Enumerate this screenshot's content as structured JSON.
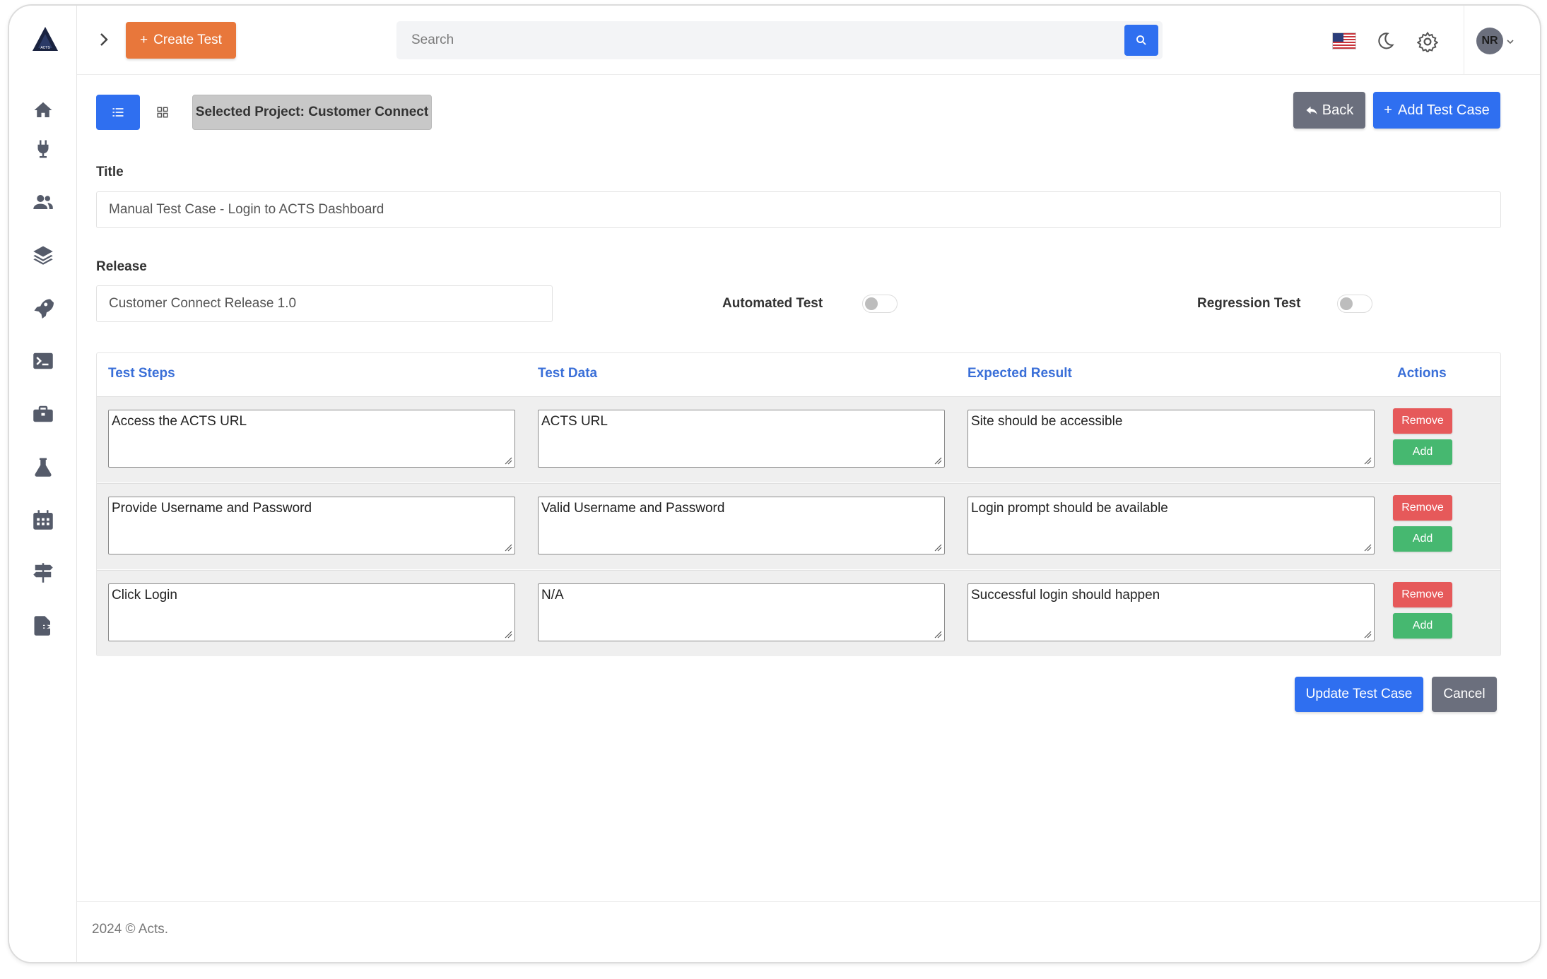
{
  "header": {
    "create_label": "Create Test",
    "search_placeholder": "Search",
    "avatar_initials": "NR"
  },
  "toolbar": {
    "project_badge": "Selected Project: Customer Connect",
    "back_label": "Back",
    "add_test_case_label": "Add Test Case"
  },
  "form": {
    "title_label": "Title",
    "title_value": "Manual Test Case - Login to ACTS Dashboard",
    "release_label": "Release",
    "release_value": "Customer Connect Release 1.0",
    "automated_label": "Automated Test",
    "automated_on": false,
    "regression_label": "Regression Test",
    "regression_on": false
  },
  "table": {
    "headers": [
      "Test Steps",
      "Test Data",
      "Expected Result",
      "Actions"
    ],
    "rows": [
      {
        "step": "Access the ACTS URL",
        "data": "ACTS URL",
        "expected": "Site should be accessible"
      },
      {
        "step": "Provide Username and Password",
        "data": "Valid Username and Password",
        "expected": "Login prompt should be available"
      },
      {
        "step": "Click Login",
        "data": "N/A",
        "expected": "Successful login should happen"
      }
    ],
    "remove_label": "Remove",
    "add_label": "Add"
  },
  "actions": {
    "update_label": "Update Test Case",
    "cancel_label": "Cancel"
  },
  "footer": {
    "text": "2024 © Acts."
  },
  "colors": {
    "primary": "#2f6ff0",
    "create": "#e8773b",
    "secondary": "#6b6f7d",
    "danger": "#e6595a",
    "success": "#46b870",
    "header_link": "#3a6fd8"
  },
  "icons": {
    "sidebar": [
      "home-icon",
      "plug-icon",
      "users-icon",
      "layers-icon",
      "rocket-icon",
      "terminal-icon",
      "briefcase-icon",
      "flask-icon",
      "calendar-icon",
      "signpost-icon",
      "file-export-icon"
    ]
  }
}
